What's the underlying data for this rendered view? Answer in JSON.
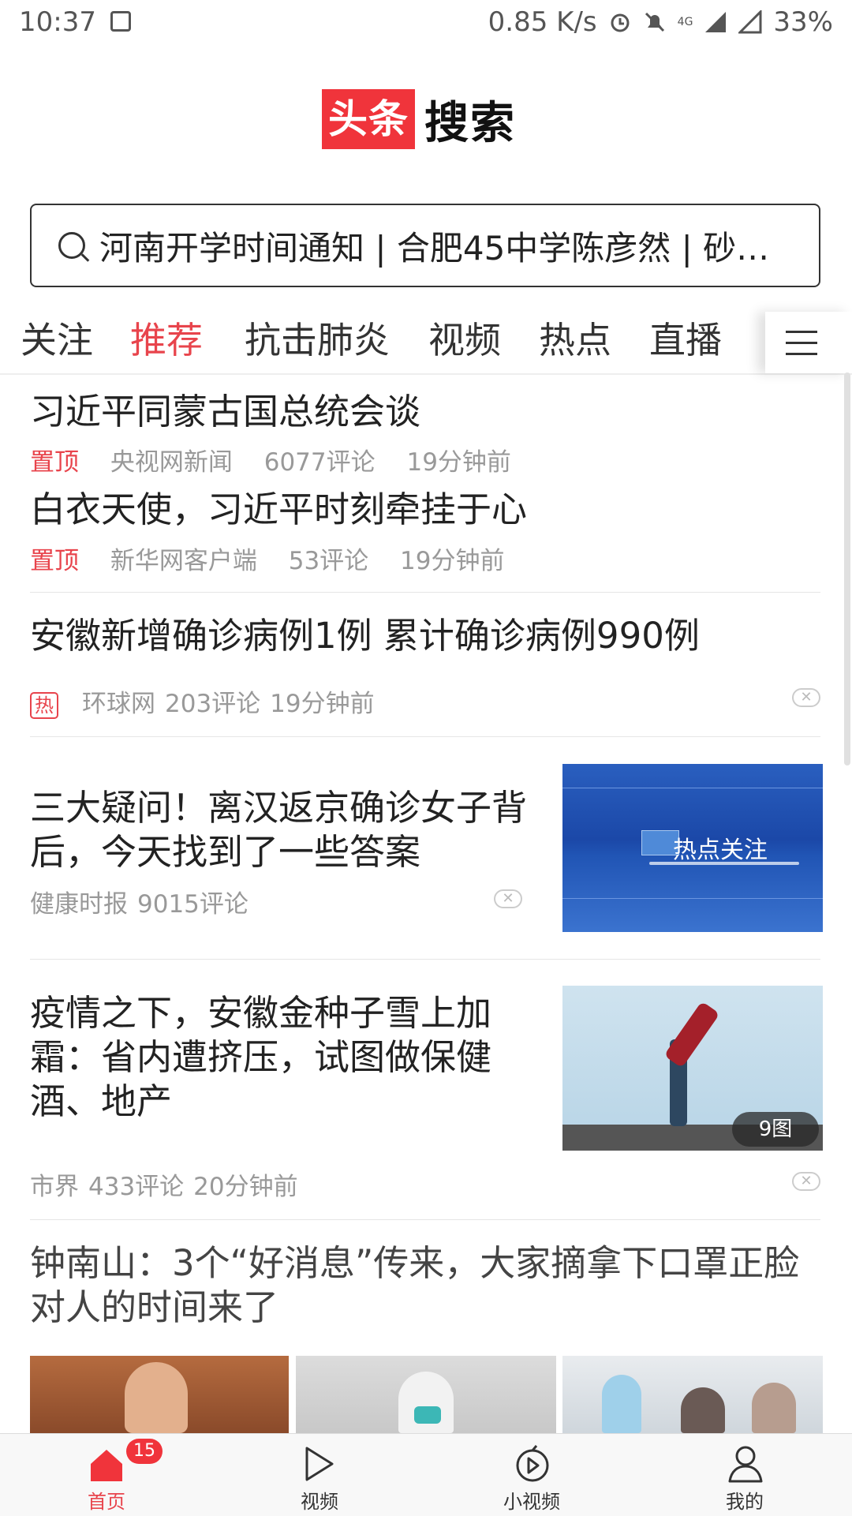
{
  "status": {
    "time": "10:37",
    "speed": "0.85 K/s",
    "network": "4G",
    "battery": "33%"
  },
  "logo": {
    "red": "头条",
    "black": "搜索"
  },
  "search": {
    "text": "河南开学时间通知 | 合肥45中学陈彦然 | 砂…"
  },
  "tabs": [
    {
      "label": "关注"
    },
    {
      "label": "推荐"
    },
    {
      "label": "抗击肺炎"
    },
    {
      "label": "视频"
    },
    {
      "label": "热点"
    },
    {
      "label": "直播"
    }
  ],
  "feed": {
    "pinned": [
      {
        "title": "习近平同蒙古国总统会谈",
        "tag": "置顶",
        "source": "央视网新闻",
        "comments": "6077评论",
        "time": "19分钟前"
      },
      {
        "title": "白衣天使，习近平时刻牵挂于心",
        "tag": "置顶",
        "source": "新华网客户端",
        "comments": "53评论",
        "time": "19分钟前"
      }
    ],
    "item1": {
      "title": "安徽新增确诊病例1例 累计确诊病例990例",
      "hot": "热",
      "source": "环球网",
      "comments": "203评论",
      "time": "19分钟前"
    },
    "item2": {
      "title_line1": "三大疑问！离汉返京确诊女子背",
      "title_line2": "后，今天找到了一些答案",
      "source": "健康时报",
      "comments": "9015评论",
      "thumb_text": "热点关注"
    },
    "item3": {
      "title_line1": "疫情之下，安徽金种子雪上加",
      "title_line2": "霜：省内遭挤压，试图做保健",
      "title_line3": "酒、地产",
      "source": "市界",
      "comments": "433评论",
      "time": "20分钟前",
      "badge": "9图"
    },
    "item4": {
      "title_line1": "钟南山：3个“好消息”传来，大家摘拿下口罩正脸",
      "title_line2": "对人的时间来了"
    }
  },
  "colors": {
    "accent": "#e8444c",
    "brand_red": "#f0343b"
  },
  "bottom_nav": {
    "badge": "15",
    "items": [
      {
        "label": "首页"
      },
      {
        "label": "视频"
      },
      {
        "label": "小视频"
      },
      {
        "label": "我的"
      }
    ]
  }
}
